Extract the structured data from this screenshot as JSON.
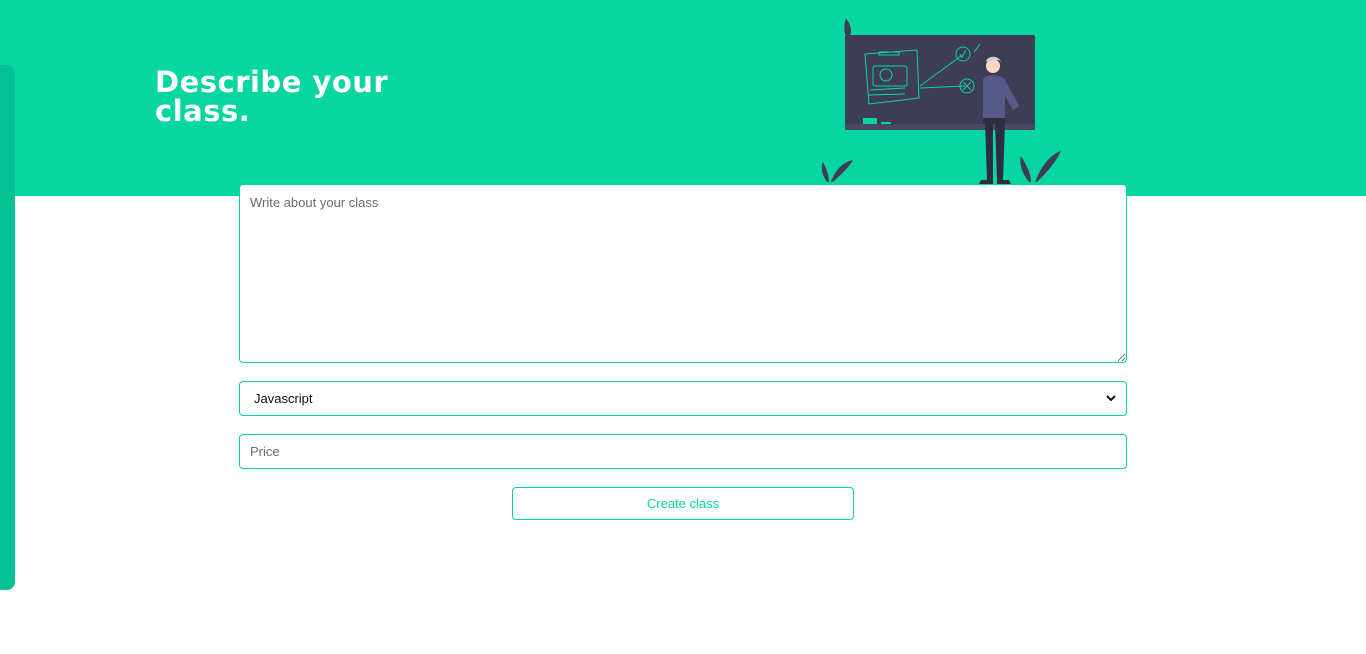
{
  "header": {
    "title_line1": "Describe your",
    "title_line2": "class."
  },
  "form": {
    "description_placeholder": "Write about your class",
    "description_value": "",
    "language_select": {
      "selected": "Javascript"
    },
    "price_placeholder": "Price",
    "price_value": "",
    "submit_label": "Create class"
  },
  "colors": {
    "accent": "#06d6a0",
    "side_strip": "#05c193",
    "board": "#3f3d56",
    "white": "#ffffff"
  },
  "icons": {
    "select": "chevron-down-icon",
    "illustration": "teacher-blackboard-illustration"
  }
}
